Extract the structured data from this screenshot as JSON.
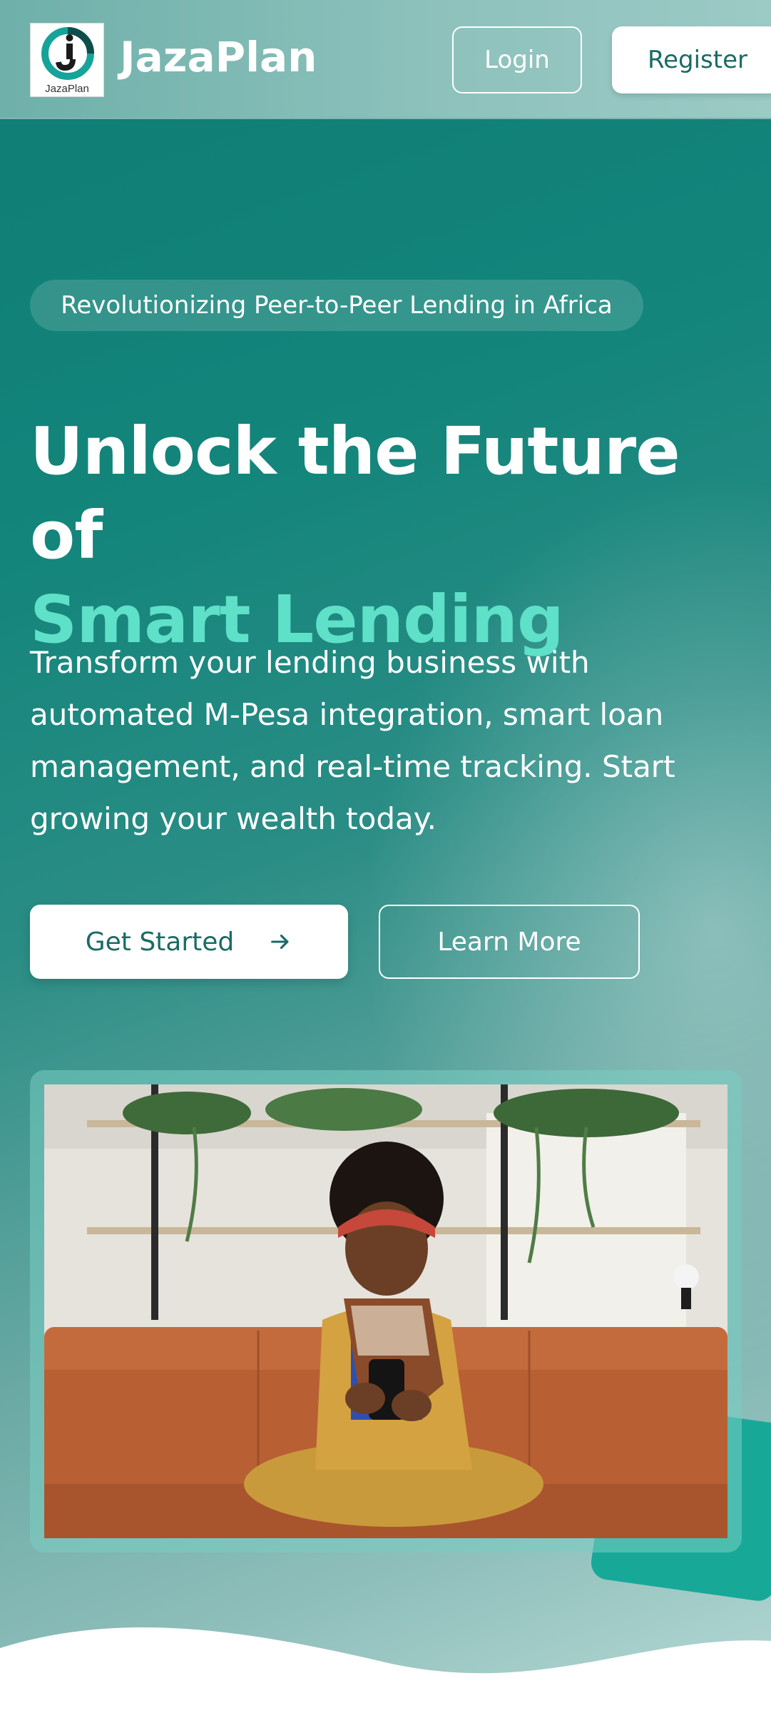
{
  "header": {
    "logo_text": "JazaPlan",
    "brand": "JazaPlan",
    "login_label": "Login",
    "register_label": "Register"
  },
  "hero": {
    "badge": "Revolutionizing Peer-to-Peer Lending in Africa",
    "headline_line1": "Unlock the Future of",
    "headline_line2": "Smart Lending",
    "description": "Transform your lending business with automated M-Pesa integration, smart loan management, and real-time tracking. Start growing your wealth today.",
    "primary_cta": "Get Started",
    "secondary_cta": "Learn More"
  },
  "icons": {
    "primary_cta_icon": "arrow-right-icon"
  },
  "colors": {
    "brand_teal": "#13857b",
    "accent_mint": "#5fe0c8",
    "button_text": "#1a6b64"
  }
}
